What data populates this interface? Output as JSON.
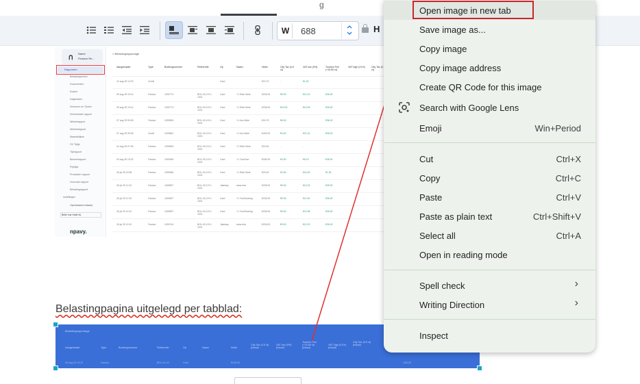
{
  "toolbar": {
    "width_label": "W",
    "width_value": "688",
    "height_label": "H",
    "step_up": "^",
    "step_down": "v",
    "top_glyph": "g"
  },
  "screenshot": {
    "logo": "ᑎ",
    "user_lines": [
      "Name",
      "Finance Re..."
    ],
    "selected_nav": "Rapporten",
    "nav_items": [
      "Betaalrapporten",
      "Documenten",
      "Kosten",
      "Dagboeken",
      "Scheuren en Tooien",
      "Scheurkaart rapport",
      "Winkelrapport",
      "Weekelrapport",
      "Maandelijkse",
      "OV Tijdje",
      "Tijdrapport",
      "Bewerkrapport",
      "Prijslijst",
      "Producten rapport",
      "Voorraad rapport",
      "Belastingrapport"
    ],
    "settings_item": "Instellingen",
    "footer_link": "Openstaand ontwerp",
    "footer_select": "Belle Vue Hotel NL",
    "brand": "npavy.",
    "page_title": "< Belastingrapportage",
    "columns": [
      "Aangemaakt",
      "Type",
      "Boekingnummer",
      "Referentie",
      "Op",
      "Naam",
      "Netto",
      "City Tax (4.5 ct)",
      "VAT low (9%)",
      "Tourism Fee (+15.60 ct)",
      "VAT high (21%)",
      "City Tax (3.5 ct)"
    ],
    "rows": [
      {
        "date": "10 aug 25 12:03",
        "type": "Credit",
        "num": "",
        "ref": "",
        "op": "Card",
        "name": "",
        "net": "€19.70",
        "a": "-",
        "b": "€1.62",
        "c": "",
        "d": ""
      },
      {
        "date": "09 aug 25 19:14",
        "type": "Factuur",
        "num": "1000773",
        "ref": "BOL-03-10+1-1001",
        "op": "Card",
        "name": "+1 Ellen Mole",
        "net": "€226.00",
        "a": "€9.00",
        "b": "€12.10",
        "c": "€26.00",
        "d": ""
      },
      {
        "date": "09 aug 25 19:14",
        "type": "Factuur",
        "num": "1000773",
        "ref": "BOL-03-10+1-1001",
        "op": "Card",
        "name": "+1 Ellen Mole",
        "net": "€228.00",
        "a": "€10.00",
        "b": "€12.53",
        "c": "€26.00",
        "d": ""
      },
      {
        "date": "07 aug 25 09:05",
        "type": "Factuur",
        "num": "1000505",
        "ref": "BOL-03-10+1-1001",
        "op": "Card",
        "name": "+1 Ann Mole",
        "net": "€16.75",
        "a": "€6.00",
        "b": "",
        "c": "€36.00",
        "d": ""
      },
      {
        "date": "07 aug 25 09:05",
        "type": "Credit",
        "num": "1000662",
        "ref": "BOL-03-10+1-1001",
        "op": "Card",
        "name": "+1 Ann Mole",
        "net": "€425.00",
        "a": "€4.00",
        "b": "€21.10",
        "c": "€26.00",
        "d": ""
      },
      {
        "date": "04 aug 25 07:05",
        "type": "Factuur",
        "num": "1000563",
        "ref": "BOL-03-10+1-1001",
        "op": "Card",
        "name": "+1 Ellen Mole",
        "net": "€15.52",
        "a": "-",
        "b": "-",
        "c": "-",
        "d": ""
      },
      {
        "date": "03 aug 25 13:32",
        "type": "Factuur",
        "num": "1000496",
        "ref": "BOL-03-10+1-1001",
        "op": "Card",
        "name": "+1 Yod Kwa",
        "net": "€180.00",
        "a": "€3.00",
        "b": "€6.10",
        "c": "€26.00",
        "d": ""
      },
      {
        "date": "26 jul 25 15:38",
        "type": "Factuur",
        "num": "1000486",
        "ref": "BOL-03-10+1-1001",
        "op": "Card",
        "name": "+1 Ellen Mole",
        "net": "€29.40",
        "a": "€2.60",
        "b": "€10.00",
        "c": "€1.52",
        "d": ""
      },
      {
        "date": "26 jul 25 12:10",
        "type": "Factuur",
        "num": "1000507",
        "ref": "BOL-03-10+1-1001",
        "op": "Jakeday",
        "name": "www.rela",
        "net": "€226.00",
        "a": "€9.00",
        "b": "€12.02",
        "c": "€29.00",
        "d": ""
      },
      {
        "date": "26 jul 25 12:10",
        "type": "Factuur",
        "num": "1000507",
        "ref": "BOL-03-10+1-1001",
        "op": "Card",
        "name": "+1 Yod Booking",
        "net": "€226.00",
        "a": "€9.00",
        "b": "€12.40",
        "c": "€26.00",
        "d": ""
      },
      {
        "date": "26 jul 25 12:10",
        "type": "Factuur",
        "num": "1000557",
        "ref": "BOL-03-10+1-1001",
        "op": "Card",
        "name": "+1 Yod Booking",
        "net": "€226.00",
        "a": "€9.00",
        "b": "€12.08",
        "c": "€26.00",
        "d": ""
      },
      {
        "date": "26 jul 25 12:10",
        "type": "Factuur",
        "num": "1000744",
        "ref": "BOL-03-10+1-1001",
        "op": "Jakeday",
        "name": "www.rela",
        "net": "€226.00",
        "a": "€9.00",
        "b": "€12.02",
        "c": "€26.00",
        "d": ""
      }
    ]
  },
  "heading": "Belastingpagina uitgelegd per tabblad:",
  "selected_image": {
    "title": "Belastingrapportage",
    "columns": [
      "Aangemaakt",
      "Type",
      "Boekingnummer",
      "Referentie",
      "Op",
      "Naam",
      "Netto",
      "City Tax (4.5 ct) (totaal)",
      "VAT low (9%) (totaal)",
      "Tourism Fee (+15.60 ct) (totaal)",
      "VAT high (21%) (totaal)",
      "City Tax (3.5 ct) (totaal)"
    ],
    "row": [
      "09 aug 25 19:14",
      "Factuur",
      "1000773",
      "BOL-03-10",
      "Card",
      "",
      "€226.00",
      "",
      "",
      "",
      "",
      "€26.00"
    ]
  },
  "context_menu": {
    "items": [
      {
        "label": "Open image in new tab",
        "shortcut": ""
      },
      {
        "label": "Save image as...",
        "shortcut": ""
      },
      {
        "label": "Copy image",
        "shortcut": ""
      },
      {
        "label": "Copy image address",
        "shortcut": ""
      },
      {
        "label": "Create QR Code for this image",
        "shortcut": ""
      },
      {
        "label": "Search with Google Lens",
        "shortcut": ""
      },
      {
        "label": "Emoji",
        "shortcut": "Win+Period"
      },
      {
        "label": "Cut",
        "shortcut": "Ctrl+X"
      },
      {
        "label": "Copy",
        "shortcut": "Ctrl+C"
      },
      {
        "label": "Paste",
        "shortcut": "Ctrl+V"
      },
      {
        "label": "Paste as plain text",
        "shortcut": "Ctrl+Shift+V"
      },
      {
        "label": "Select all",
        "shortcut": "Ctrl+A"
      },
      {
        "label": "Open in reading mode",
        "shortcut": ""
      },
      {
        "label": "Spell check",
        "shortcut": ""
      },
      {
        "label": "Writing Direction",
        "shortcut": ""
      },
      {
        "label": "Inspect",
        "shortcut": ""
      }
    ]
  },
  "colors": {
    "highlight_red": "#c9252c",
    "selection_blue": "#3a6fd8",
    "menu_bg": "#edf3ec",
    "toolbar_bg": "#f0f4f9"
  }
}
